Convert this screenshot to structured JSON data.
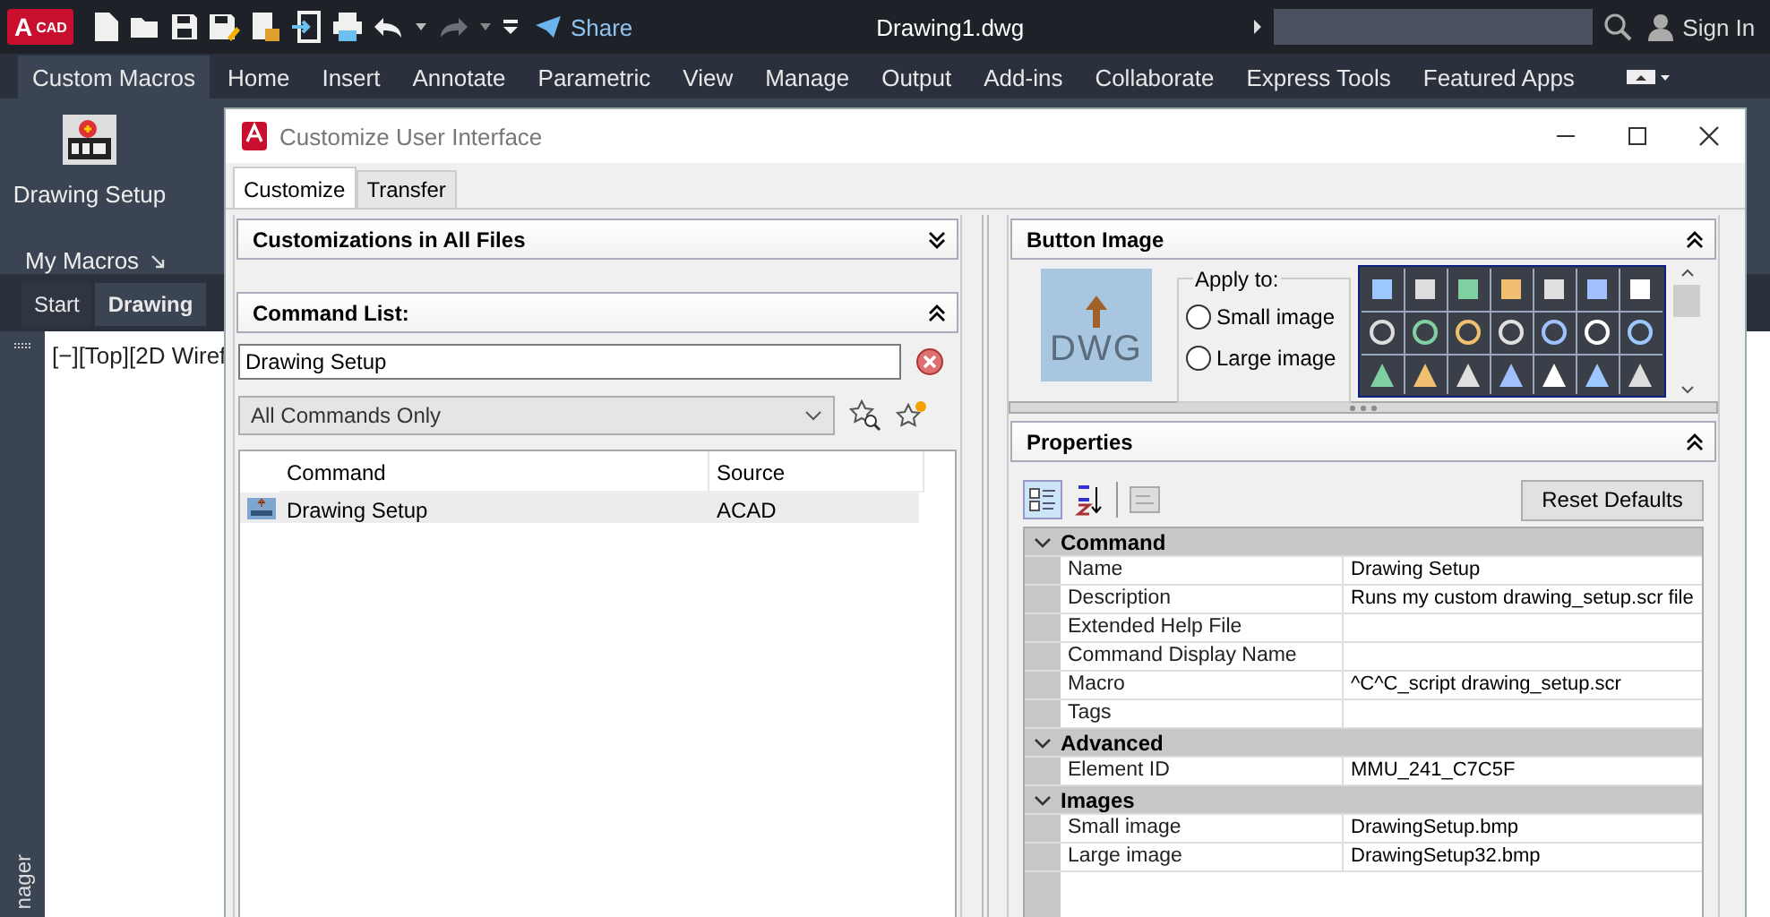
{
  "app": {
    "logo": "A",
    "logo_sub": "CAD",
    "title": "Drawing1.dwg",
    "share": "Share",
    "sign_in": "Sign In"
  },
  "ribbon_tabs": [
    {
      "label": "Custom Macros",
      "selected": true
    },
    {
      "label": "Home",
      "selected": false
    },
    {
      "label": "Insert",
      "selected": false
    },
    {
      "label": "Annotate",
      "selected": false
    },
    {
      "label": "Parametric",
      "selected": false
    },
    {
      "label": "View",
      "selected": false
    },
    {
      "label": "Manage",
      "selected": false
    },
    {
      "label": "Output",
      "selected": false
    },
    {
      "label": "Add-ins",
      "selected": false
    },
    {
      "label": "Collaborate",
      "selected": false
    },
    {
      "label": "Express Tools",
      "selected": false
    },
    {
      "label": "Featured Apps",
      "selected": false
    }
  ],
  "ribbon_panel": {
    "button": "Drawing Setup",
    "panel_title": "My Macros"
  },
  "file_tabs": [
    {
      "label": "Start",
      "selected": false
    },
    {
      "label": "Drawing",
      "selected": true
    }
  ],
  "viewport": {
    "label": "[−][Top][2D Wiref"
  },
  "side_palette": {
    "label": "nager"
  },
  "dialog": {
    "title": "Customize User Interface",
    "tabs": [
      {
        "label": "Customize",
        "selected": true
      },
      {
        "label": "Transfer",
        "selected": false
      }
    ],
    "customizations": {
      "title": "Customizations in All Files",
      "expanded": false
    },
    "command_list": {
      "title": "Command List:",
      "expanded": true,
      "search": {
        "value": "Drawing Setup"
      },
      "filter": "All Commands Only",
      "columns": [
        "Command",
        "Source"
      ],
      "rows": [
        {
          "command": "Drawing Setup",
          "source": "ACAD",
          "selected": true
        }
      ]
    },
    "button_image": {
      "title": "Button Image",
      "expanded": true,
      "preview": "DWG",
      "group_label": "Apply to:",
      "options": [
        {
          "label": "Small image",
          "selected": false
        },
        {
          "label": "Large image",
          "selected": false
        }
      ]
    },
    "properties": {
      "title": "Properties",
      "expanded": true,
      "reset": "Reset Defaults",
      "categories": [
        {
          "name": "Command",
          "expanded": true,
          "rows": [
            {
              "name": "Name",
              "value": "Drawing Setup"
            },
            {
              "name": "Description",
              "value": "Runs my custom drawing_setup.scr file"
            },
            {
              "name": "Extended Help File"
            },
            {
              "name": "Command Display Name"
            },
            {
              "name": "Macro",
              "value": "^C^C_script drawing_setup.scr"
            },
            {
              "name": "Tags"
            }
          ]
        },
        {
          "name": "Advanced",
          "expanded": true,
          "rows": [
            {
              "name": "Element ID",
              "value": "MMU_241_C7C5F"
            }
          ]
        },
        {
          "name": "Images",
          "expanded": true,
          "rows": [
            {
              "name": "Small image",
              "value": "DrawingSetup.bmp"
            },
            {
              "name": "Large image",
              "value": "DrawingSetup32.bmp"
            }
          ]
        }
      ]
    }
  }
}
